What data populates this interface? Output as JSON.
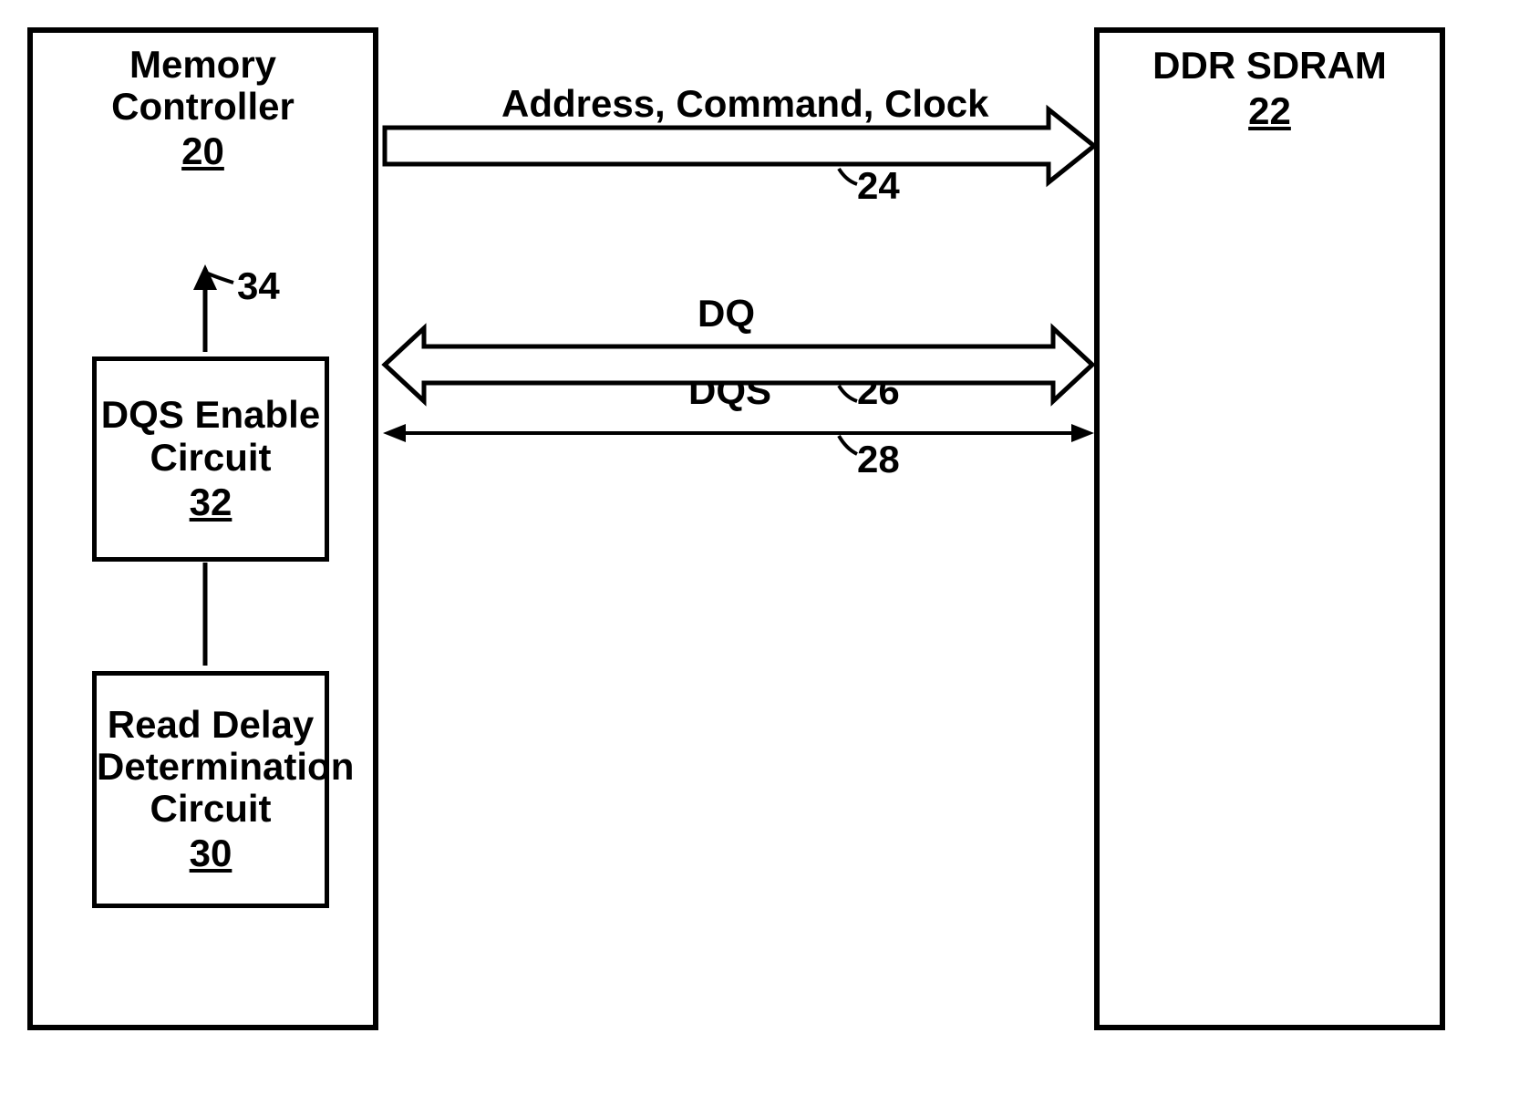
{
  "memory_controller": {
    "title_line1": "Memory",
    "title_line2": "Controller",
    "number": "20"
  },
  "dqs_enable": {
    "title_line1": "DQS Enable",
    "title_line2": "Circuit",
    "number": "32"
  },
  "read_delay": {
    "title_line1": "Read Delay",
    "title_line2": "Determination",
    "title_line3": "Circuit",
    "number": "30"
  },
  "ddr_sdram": {
    "title": "DDR SDRAM",
    "number": "22"
  },
  "signals": {
    "address_cmd_clock": "Address, Command, Clock",
    "dq": "DQ",
    "dqs": "DQS"
  },
  "refs": {
    "ref24": "24",
    "ref26": "26",
    "ref28": "28",
    "ref34": "34"
  }
}
